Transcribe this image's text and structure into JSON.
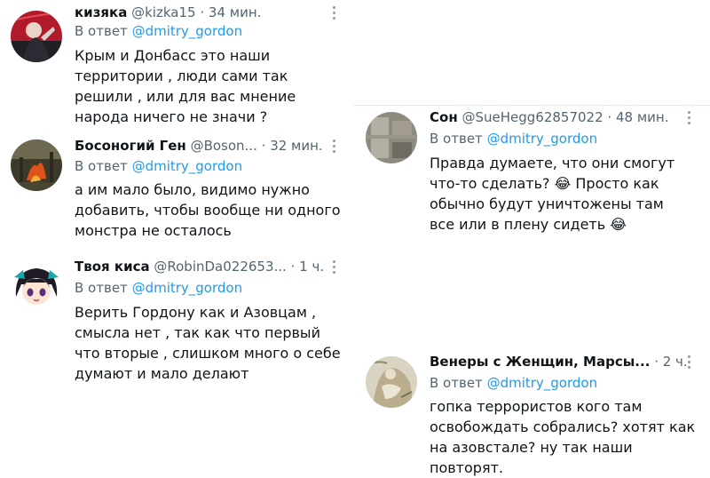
{
  "tweets": [
    {
      "name": "кизяка",
      "handle": "@kizka15",
      "dot": "·",
      "time": "34 мин.",
      "reply_prefix": "В ответ",
      "reply_to": "@dmitry_gordon",
      "text": "Крым и Донбасс это наши территории , люди сами так решили , или для вас мнение народа ничего не значи ?",
      "avatar": "red-figure-avatar"
    },
    {
      "name": "Босоногий Ген",
      "handle": "@Boson...",
      "dot": "·",
      "time": "32 мин.",
      "reply_prefix": "В ответ",
      "reply_to": "@dmitry_gordon",
      "text": "а им мало было, видимо нужно добавить, чтобы вообще ни одного монстра не осталось",
      "avatar": "fire-avatar"
    },
    {
      "name": "Твоя киса",
      "handle": "@RobinDa022653...",
      "dot": "·",
      "time": "1 ч.",
      "reply_prefix": "В ответ",
      "reply_to": "@dmitry_gordon",
      "text": "Верить Гордону как и Азовцам , смысла нет , так как что первый что вторые , слишком много о себе думают и мало делают",
      "avatar": "anime-girl-avatar"
    },
    {
      "name": "Сон",
      "handle": "@SueHegg62857022",
      "dot": "·",
      "time": "48 мин.",
      "reply_prefix": "В ответ",
      "reply_to": "@dmitry_gordon",
      "text_parts": [
        "Правда думаете, что они смогут что-то сделать? ",
        "😂",
        " Просто как обычно будут уничтожены там все или в плену сидеть ",
        "😂"
      ],
      "avatar": "grey-blur-avatar"
    },
    {
      "name": "Венеры с Женщин, Марсы...",
      "handle": "",
      "dot": "·",
      "time": "2 ч.",
      "reply_prefix": "В ответ",
      "reply_to": "@dmitry_gordon",
      "text": "гопка террористов кого там освобождать собрались? хотят как на азовстале? ну так наши повторят.",
      "avatar": "painting-avatar"
    }
  ],
  "icons": {
    "more": "more-options-icon",
    "laugh": "tears-of-joy-emoji"
  }
}
